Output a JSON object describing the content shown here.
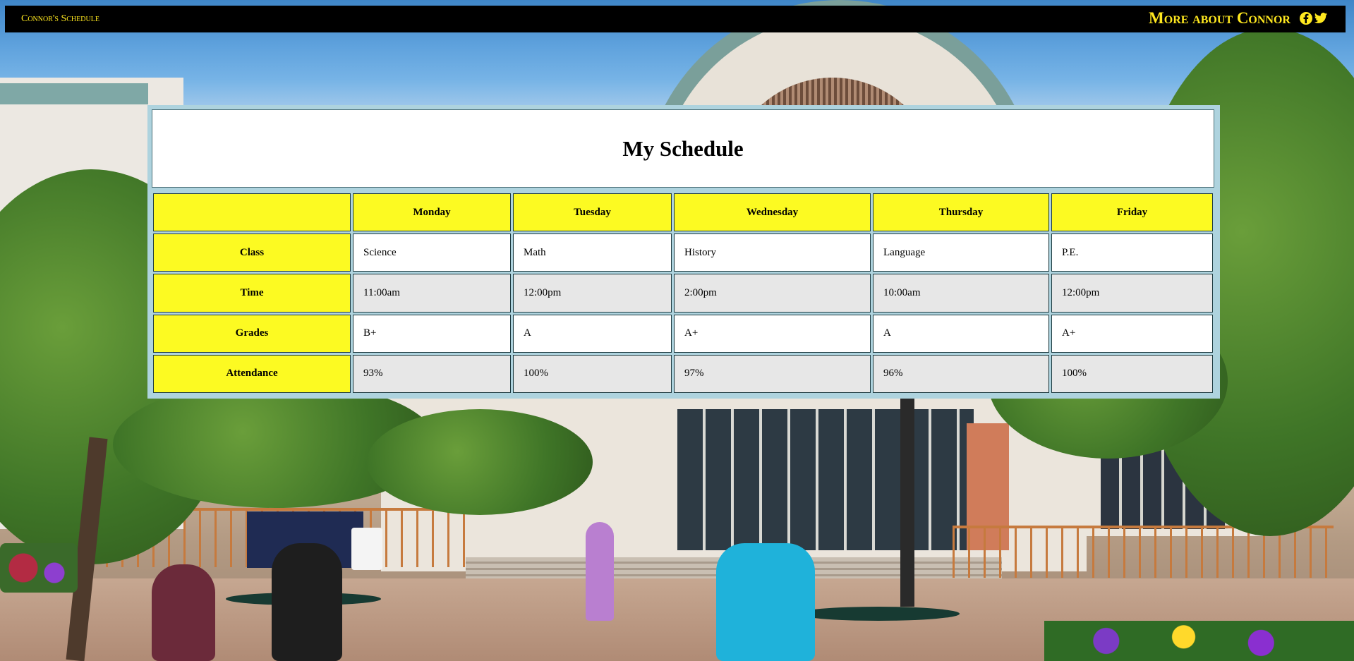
{
  "navbar": {
    "brand": "Connor's Schedule",
    "about_link": "More about Connor",
    "social": [
      {
        "icon": "facebook-icon"
      },
      {
        "icon": "twitter-icon"
      }
    ],
    "text_color": "#ffe81f"
  },
  "schedule": {
    "title": "My Schedule",
    "days": [
      "Monday",
      "Tuesday",
      "Wednesday",
      "Thursday",
      "Friday"
    ],
    "rows": [
      {
        "label": "Class",
        "values": [
          "Science",
          "Math",
          "History",
          "Language",
          "P.E."
        ]
      },
      {
        "label": "Time",
        "values": [
          "11:00am",
          "12:00pm",
          "2:00pm",
          "10:00am",
          "12:00pm"
        ]
      },
      {
        "label": "Grades",
        "values": [
          "B+",
          "A",
          "A+",
          "A",
          "A+"
        ]
      },
      {
        "label": "Attendance",
        "values": [
          "93%",
          "100%",
          "97%",
          "96%",
          "100%"
        ]
      }
    ],
    "header_color": "#fcfa22",
    "border_color": "#aed3de"
  }
}
